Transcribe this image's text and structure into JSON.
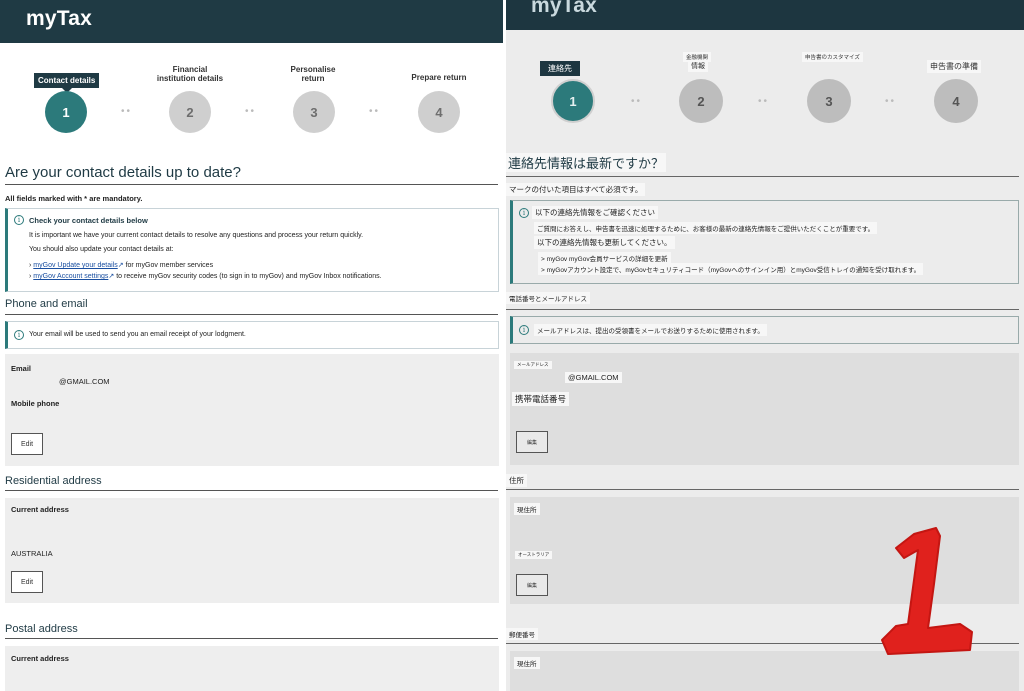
{
  "left": {
    "brand": "myTax",
    "steps": [
      {
        "label": "Contact details",
        "number": "1",
        "active": true
      },
      {
        "label": "Financial institution details",
        "number": "2"
      },
      {
        "label": "Personalise return",
        "number": "3"
      },
      {
        "label": "Prepare return",
        "number": "4"
      }
    ],
    "title": "Are your contact details up to date?",
    "mandatory_note": "All fields marked with * are mandatory.",
    "check_box": {
      "title": "Check your contact details below",
      "line1": "It is important we have your current contact details to resolve any questions and process your return quickly.",
      "line2": "You should also update your contact details at:",
      "link1_text": "myGov Update your details",
      "link1_suffix": "for myGov member services",
      "link2_text": "myGov Account settings",
      "link2_suffix": "to receive myGov security codes (to sign in to myGov) and myGov Inbox notifications."
    },
    "phone_email": {
      "heading": "Phone and email",
      "info": "Your email will be used to send you an email receipt of your lodgment.",
      "email_label": "Email",
      "email_value": "@GMAIL.COM",
      "mobile_label": "Mobile phone",
      "edit_label": "Edit"
    },
    "residential": {
      "heading": "Residential address",
      "current_label": "Current address",
      "country": "AUSTRALIA",
      "edit_label": "Edit"
    },
    "postal": {
      "heading": "Postal address",
      "current_label": "Current address"
    }
  },
  "right": {
    "brand": "myTax",
    "steps": [
      {
        "label": "連絡先",
        "number": "1",
        "active": true
      },
      {
        "label_line1": "金融機関",
        "label_line2": "情報",
        "number": "2"
      },
      {
        "label": "申告書のカスタマイズ",
        "number": "3"
      },
      {
        "label": "申告書の準備",
        "number": "4"
      }
    ],
    "title": "連絡先情報は最新ですか？",
    "mandatory_note": "マークの付いた項目はすべて必須です。",
    "check_box": {
      "title": "以下の連絡先情報をご確認ください",
      "line1": "ご質問にお答えし、申告書を迅速に処理するために、お客様の最新の連絡先情報をご提供いただくことが重要です。",
      "line2": "以下の連絡先情報も更新してください。",
      "line3": "> myGov myGov会員サービスの詳細を更新",
      "line4": "> myGovアカウント設定で、myGovセキュリティコード（myGovへのサインイン用）とmyGov受信トレイの通知を受け取れます。"
    },
    "phone_email": {
      "heading": "電話番号とメールアドレス",
      "info": "メールアドレスは、提出の受領書をメールでお送りするために使用されます。",
      "email_label": "メールアドレス",
      "email_value": "@GMAIL.COM",
      "mobile_label": "携帯電話番号",
      "edit_label": "編集"
    },
    "residential": {
      "heading": "住所",
      "current_label": "現住所",
      "country": "オーストラリア",
      "edit_label": "編集"
    },
    "postal": {
      "heading": "郵便番号",
      "current_label": "現住所"
    },
    "annotation_number": "1",
    "annotation_color": "#e0211d"
  },
  "colors": {
    "header": "#1f3a44",
    "accent": "#2c7a7b",
    "link": "#1a4fa0"
  }
}
